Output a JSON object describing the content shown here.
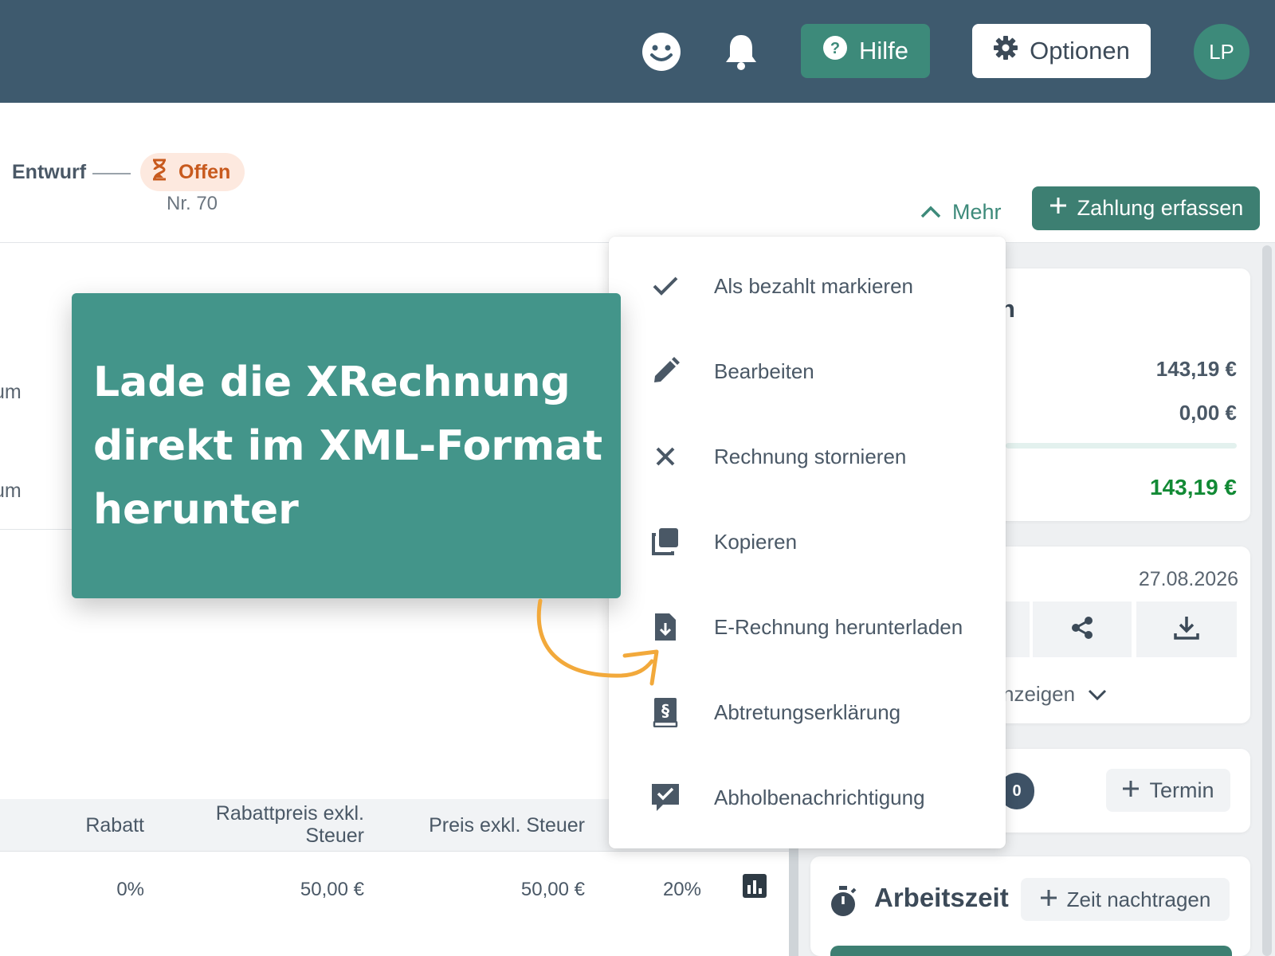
{
  "topbar": {
    "help_label": "Hilfe",
    "options_label": "Optionen",
    "avatar_initials": "LP"
  },
  "header": {
    "status_draft": "Entwurf",
    "status_open": "Offen",
    "invoice_number": "Nr. 70",
    "more_label": "Mehr",
    "add_payment_label": "Zahlung erfassen"
  },
  "left": {
    "label_1": "um",
    "label_2": "um"
  },
  "table": {
    "headers": {
      "discount": "Rabatt",
      "discount_price_line1": "Rabattpreis exkl.",
      "discount_price_line2": "Steuer",
      "price_excl_tax": "Preis exkl. Steuer"
    },
    "row": {
      "discount": "0%",
      "discount_price": "50,00 €",
      "price_excl_tax": "50,00 €",
      "tax": "20%"
    }
  },
  "menu": {
    "items": [
      {
        "label": "Als bezahlt markieren",
        "icon": "check-icon"
      },
      {
        "label": "Bearbeiten",
        "icon": "pencil-icon"
      },
      {
        "label": "Rechnung stornieren",
        "icon": "close-icon"
      },
      {
        "label": "Kopieren",
        "icon": "copy-icon"
      },
      {
        "label": "E-Rechnung herunterladen",
        "icon": "file-download-icon"
      },
      {
        "label": "Abtretungserklärung",
        "icon": "paragraph-book-icon"
      },
      {
        "label": "Abholbenachrichtigung",
        "icon": "message-check-icon"
      }
    ]
  },
  "callout": {
    "line1": "Lade die XRechnung",
    "line2": "direkt im XML-Format",
    "line3": "herunter"
  },
  "right": {
    "summary_title_fragment": "n",
    "amount_1": "143,19 €",
    "amount_2": "0,00 €",
    "amount_total": "143,19 €",
    "doc_date": "27.08.2026",
    "show_more_fragment": "nzeigen",
    "appointment_count": "0",
    "add_appointment_label": "Termin",
    "worktime_title": "Arbeitszeit",
    "add_time_label": "Zeit nachtragen"
  },
  "colors": {
    "topbar": "#3e5a6e",
    "accent_green": "#3d8a7a",
    "callout": "#43958a",
    "open_badge_bg": "#fde9df",
    "open_badge_text": "#c85a1e",
    "total_amount": "#128a35",
    "arrow": "#f2a93b"
  }
}
